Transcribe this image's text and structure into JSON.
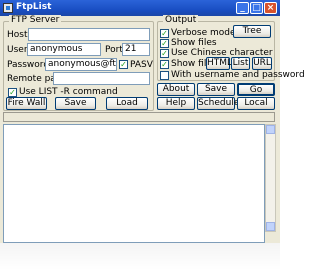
{
  "window": {
    "title": "FtpList",
    "controls": [
      "_",
      "□",
      "×"
    ]
  },
  "ftp_server": {
    "legend": "FTP Server",
    "host_label": "Host",
    "host_value": "",
    "user_label": "User",
    "user_value": "anonymous",
    "port_label": "Port",
    "port_value": "21",
    "password_label": "Password",
    "password_value": "anonymous@ftplist.",
    "pasv_label": "PASV",
    "pasv_checked": true,
    "remote_path_label": "Remote path",
    "remote_path_value": "",
    "list_r_label": "Use LIST -R command",
    "list_r_checked": true,
    "firewall_button": "Fire Wall",
    "save_button": "Save",
    "load_button": "Load"
  },
  "output": {
    "legend": "Output",
    "verbose_label": "Verbose mode",
    "verbose_checked": true,
    "tree_button": "Tree",
    "show_files_label": "Show files",
    "show_files_checked": true,
    "chinese_label": "Use Chinese character",
    "chinese_checked": true,
    "show_files2_label": "Show files",
    "show_files2_checked": true,
    "html_button": "HTML",
    "list_button": "List",
    "url_button": "URL",
    "with_user_label": "With username and password",
    "with_user_checked": false
  },
  "actions": {
    "about": "About",
    "save": "Save",
    "go": "Go",
    "help": "Help",
    "schedule": "Schedule",
    "local": "Local"
  },
  "colors": {
    "titlebar": "#1a4fc4",
    "check": "#21a121",
    "window_bg": "#ece9d8"
  }
}
